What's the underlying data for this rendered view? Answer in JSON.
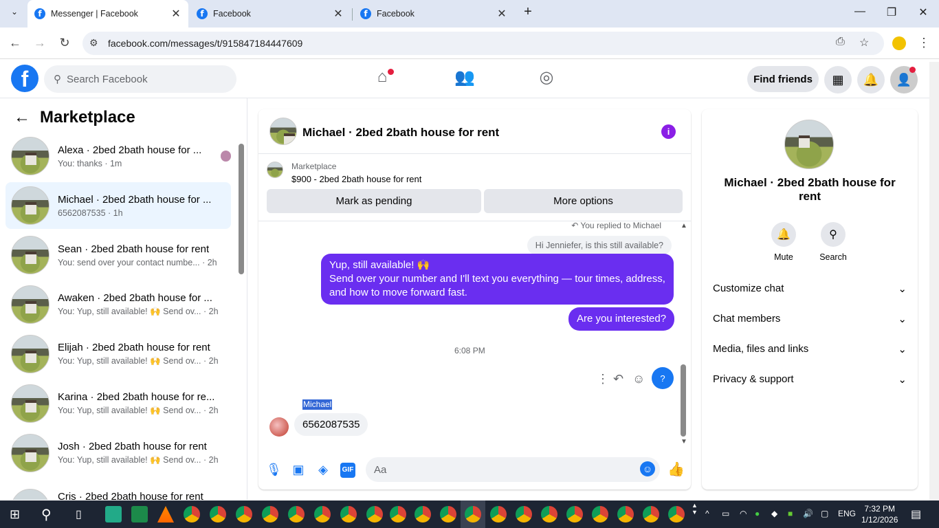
{
  "browser": {
    "tabs": [
      {
        "title": "Messenger | Facebook"
      },
      {
        "title": "Facebook"
      },
      {
        "title": "Facebook"
      }
    ],
    "url": "facebook.com/messages/t/915847184447609"
  },
  "fb_header": {
    "search_placeholder": "Search Facebook",
    "find_friends": "Find friends"
  },
  "left_panel": {
    "title": "Marketplace",
    "conversations": [
      {
        "name": "Alexa · 2bed 2bath house for ...",
        "preview": "You: thanks · 1m"
      },
      {
        "name": "Michael · 2bed 2bath house for ...",
        "preview": "6562087535 · 1h"
      },
      {
        "name": "Sean · 2bed 2bath house for rent",
        "preview": "You: send over your contact numbe... · 2h"
      },
      {
        "name": "Awaken · 2bed 2bath house for ...",
        "preview": "You: Yup, still available! 🙌 Send ov... · 2h"
      },
      {
        "name": "Elijah · 2bed 2bath house for rent",
        "preview": "You: Yup, still available! 🙌 Send ov... · 2h"
      },
      {
        "name": "Karina · 2bed 2bath house for re...",
        "preview": "You: Yup, still available! 🙌 Send ov... · 2h"
      },
      {
        "name": "Josh · 2bed 2bath house for rent",
        "preview": "You: Yup, still available! 🙌 Send ov... · 2h"
      },
      {
        "name": "Cris · 2bed 2bath house for rent",
        "preview": ""
      }
    ]
  },
  "chat": {
    "title": "Michael · 2bed 2bath house for rent",
    "marketplace_label": "Marketplace",
    "listing": "$900 - 2bed 2bath house for rent",
    "mark_pending": "Mark as pending",
    "more_options": "More options",
    "replied": "You replied to Michael",
    "quoted": "Hi Jenniefer, is this still available?",
    "msg1_line1": "Yup, still available! 🙌",
    "msg1_line2": "Send over your number and I'll text you everything — tour times, address,",
    "msg1_line3": "and how to move forward fast.",
    "msg2": "Are you interested?",
    "timestamp": "6:08 PM",
    "sender": "Michael",
    "incoming": "6562087535",
    "compose_placeholder": "Aa",
    "help": "?"
  },
  "right_panel": {
    "title": "Michael · 2bed 2bath house for rent",
    "mute": "Mute",
    "search": "Search",
    "sections": [
      "Customize chat",
      "Chat members",
      "Media, files and links",
      "Privacy & support"
    ]
  },
  "taskbar": {
    "lang": "ENG",
    "time": "7:32 PM",
    "date": "1/12/2026"
  }
}
